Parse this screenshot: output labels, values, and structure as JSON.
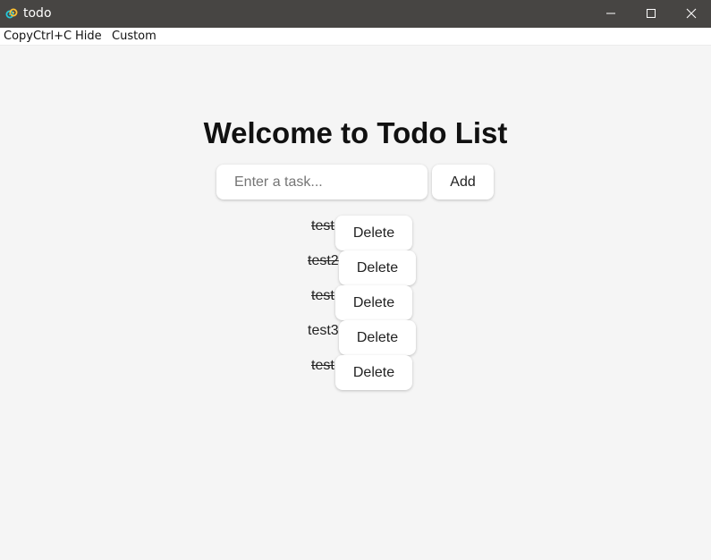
{
  "window": {
    "title": "todo",
    "icon": "tauri-logo-icon",
    "controls": [
      "minimize-icon",
      "maximize-icon",
      "close-icon"
    ]
  },
  "menu": {
    "items": [
      "CopyCtrl+C",
      "Hide",
      "Custom"
    ]
  },
  "page": {
    "heading": "Welcome to Todo List"
  },
  "form": {
    "input_value": "",
    "placeholder": "Enter a task...",
    "add_label": "Add"
  },
  "todos": [
    {
      "text": "test",
      "completed": true,
      "delete_label": "Delete"
    },
    {
      "text": "test2",
      "completed": true,
      "delete_label": "Delete"
    },
    {
      "text": "test",
      "completed": true,
      "delete_label": "Delete"
    },
    {
      "text": "test3",
      "completed": false,
      "delete_label": "Delete"
    },
    {
      "text": "test",
      "completed": true,
      "delete_label": "Delete"
    }
  ],
  "colors": {
    "titlebar_bg": "#474543",
    "page_bg": "#f5f5f5",
    "button_bg": "#ffffff"
  }
}
